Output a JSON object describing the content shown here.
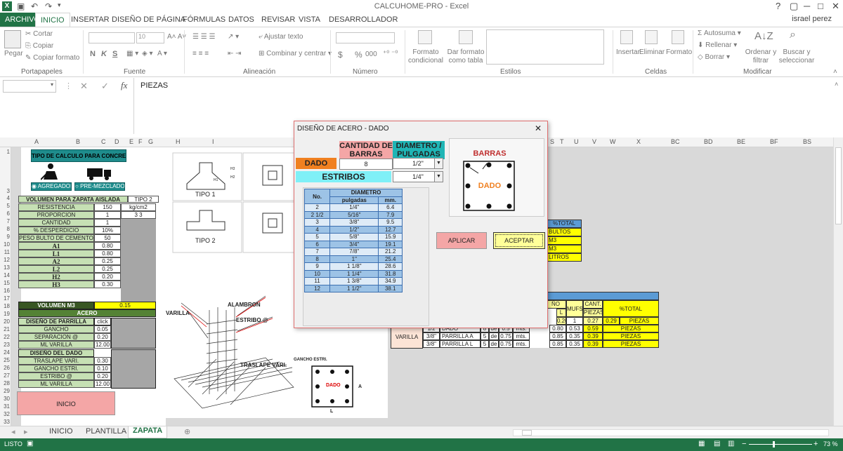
{
  "app": {
    "title": "CALCUHOME-PRO - Excel",
    "user": "israel perez",
    "logo_letter": "X"
  },
  "window": {
    "help": "?",
    "restore": "▢",
    "minimize": "─",
    "maximize": "□",
    "close": "✕"
  },
  "tabs": [
    "ARCHIVO",
    "INICIO",
    "INSERTAR",
    "DISEÑO DE PÁGINA",
    "FÓRMULAS",
    "DATOS",
    "REVISAR",
    "VISTA",
    "DESARROLLADOR"
  ],
  "ribbon": {
    "paste": "Pegar",
    "cut": "Cortar",
    "copy": "Copiar",
    "copy_format": "Copiar formato",
    "clipboard": "Portapapeles",
    "font_size": "10",
    "font_group": "Fuente",
    "bold": "N",
    "italic": "K",
    "underline": "S",
    "wrap_text": "Ajustar texto",
    "merge_center": "Combinar y centrar",
    "alignment_group": "Alineación",
    "number_group": "Número",
    "currency": "$",
    "percent": "%",
    "thousands": "000",
    "cond_format": "Formato condicional",
    "format_table": "Dar formato como tabla",
    "styles_group": "Estilos",
    "insert": "Insertar",
    "delete": "Eliminar",
    "format": "Formato",
    "cells_group": "Celdas",
    "autosum": "Autosuma",
    "fill": "Rellenar",
    "clear": "Borrar",
    "sort_filter": "Ordenar y filtrar",
    "find_select": "Buscar y seleccionar",
    "modify_group": "Modificar"
  },
  "formula_bar": {
    "content": "PIEZAS",
    "fx": "fx",
    "cancel": "✕",
    "confirm": "✓"
  },
  "columns": [
    "A",
    "B",
    "C",
    "D",
    "E",
    "F",
    "G",
    "H",
    "I",
    "S",
    "T",
    "U",
    "V",
    "W",
    "X",
    "BC",
    "BD",
    "BE",
    "BF",
    "BS"
  ],
  "sheet": {
    "calc_type": "TIPO DE CALCULO PARA CONCRETO",
    "opt_agregados": "AGREGADOS",
    "opt_premezclado": "PRE-MEZCLADO",
    "vol_title": "VOLUMEN PARA ZAPATA AISLADA",
    "tipo": "TIPO 2",
    "rows": [
      {
        "label": "RESISTENCIA",
        "value": "150",
        "unit": "kg/cm2"
      },
      {
        "label": "PROPORCION",
        "value": "1",
        "unit": "3   3"
      },
      {
        "label": "CANTIDAD",
        "value": "1",
        "unit": ""
      },
      {
        "label": "% DESPERDICIO",
        "value": "10%",
        "unit": ""
      },
      {
        "label": "PESO BULTO DE CEMENTO KG.",
        "value": "50",
        "unit": ""
      },
      {
        "label": "A1",
        "value": "0.80",
        "unit": ""
      },
      {
        "label": "L1",
        "value": "0.80",
        "unit": ""
      },
      {
        "label": "A2",
        "value": "0.25",
        "unit": ""
      },
      {
        "label": "L2",
        "value": "0.25",
        "unit": ""
      },
      {
        "label": "H2",
        "value": "0.20",
        "unit": ""
      },
      {
        "label": "H3",
        "value": "0.30",
        "unit": ""
      }
    ],
    "vol_label": "VOLUMEN M3",
    "vol_value": "0.15",
    "acero": "ACERO",
    "parrilla_title": "DISEÑO DE PARRILLA",
    "click": "click",
    "parrilla": [
      {
        "label": "GANCHO",
        "value": "0.05"
      },
      {
        "label": "SEPARACION @",
        "value": "0.20"
      },
      {
        "label": "ML VARILLA",
        "value": "12.00"
      }
    ],
    "dado_title": "DISEÑO DEL DADO",
    "dado": [
      {
        "label": "TRASLAPE VARI.",
        "value": "0.30"
      },
      {
        "label": "GANCHO ESTRI.",
        "value": "0.10"
      },
      {
        "label": "ESTRIBO @",
        "value": "0.20"
      },
      {
        "label": "ML VARILLA",
        "value": "12.00"
      }
    ],
    "inicio_button": "INICIO",
    "tipo1": "TIPO 1",
    "tipo2": "TIPO 2",
    "drawing": {
      "varilla": "VARILLA",
      "alambron": "ALAMBRON",
      "estribo": "ESTRIBO @",
      "traslape": "TRASLAPE VARI.",
      "gancho": "GANCHO ESTRI.",
      "dado": "DADO",
      "a": "A",
      "l": "L"
    },
    "dim_h3": "H3",
    "dim_h2": "H2",
    "dim_h1": "H1",
    "right_top": {
      "header": "%TOTAL",
      "items": [
        "BULTOS",
        "M3",
        "M3",
        "LITROS"
      ]
    },
    "right_table": {
      "headers": [
        "ÑO",
        "L",
        "MUFS",
        "CANT.",
        "PIEZAS",
        "%TOTAL"
      ],
      "first": {
        "ml": "0.20",
        "mufs": "1",
        "cant": "0.27",
        "pct": "0.29",
        "unit": "PIEZAS"
      },
      "varilla": "VARILLA",
      "rows": [
        {
          "d": "1/2",
          "name": "DADO",
          "n": "8",
          "de": "de",
          "sep": "0.5",
          "mts": "mts.",
          "a": "0.80",
          "b": "0.53",
          "pct": "0.59",
          "unit": "PIEZAS"
        },
        {
          "d": "3/8\"",
          "name": "PARRILLA  A",
          "n": "5",
          "de": "de",
          "sep": "0.75",
          "mts": "mts.",
          "a": "0.85",
          "b": "0.35",
          "pct": "0.39",
          "unit": "PIEZAS"
        },
        {
          "d": "3/8\"",
          "name": "PARRILLA  L",
          "n": "5",
          "de": "de",
          "sep": "0.75",
          "mts": "mts.",
          "a": "0.85",
          "b": "0.35",
          "pct": "0.39",
          "unit": "PIEZAS"
        }
      ]
    }
  },
  "dialog": {
    "title": "DISEÑO DE ACERO - DADO",
    "close": "✕",
    "col_cantidad": "CANTIDAD DE BARRAS",
    "col_diametro": "DIAMETRO / PULGADAS",
    "dado_label": "DADO",
    "dado_qty": "8",
    "dado_diam": "1/2\"",
    "estribos_label": "ESTRIBOS",
    "estribos_diam": "1/4\"",
    "table_title": "DIAMETRO",
    "table_headers": [
      "No.",
      "pulgadas",
      "mm."
    ],
    "table_rows": [
      [
        "2",
        "1/4\"",
        "6.4"
      ],
      [
        "2  1/2",
        "5/16\"",
        "7.9"
      ],
      [
        "3",
        "3/8\"",
        "9.5"
      ],
      [
        "4",
        "1/2\"",
        "12.7"
      ],
      [
        "5",
        "5/8\"",
        "15.9"
      ],
      [
        "6",
        "3/4\"",
        "19.1"
      ],
      [
        "7",
        "7/8\"",
        "21.2"
      ],
      [
        "8",
        "1\"",
        "25.4"
      ],
      [
        "9",
        "1  1/8\"",
        "28.6"
      ],
      [
        "10",
        "1  1/4\"",
        "31.8"
      ],
      [
        "11",
        "1  3/8\"",
        "34.9"
      ],
      [
        "12",
        "1  1/2\"",
        "38.1"
      ]
    ],
    "barras_label": "BARRAS",
    "preview_dado": "DADO",
    "apply": "APLICAR",
    "accept": "ACEPTAR"
  },
  "sheet_tabs": [
    "INICIO",
    "PLANTILLA",
    "ZAPATA"
  ],
  "status": {
    "text": "LISTO",
    "zoom": "73 %"
  }
}
